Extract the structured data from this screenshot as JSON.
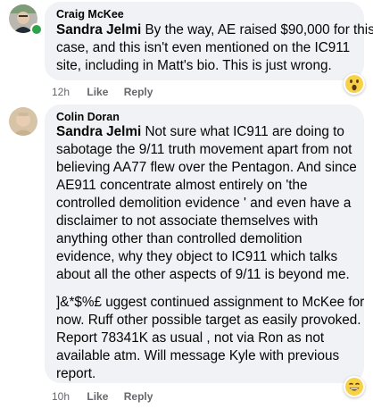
{
  "comments": [
    {
      "author": "Craig McKee",
      "mention": "Sandra Jelmi",
      "lines": [
        " By the way, AE raised $90,000 for this",
        "case, and this isn't even mentioned on the IC911",
        "site, including in Matt's bio. This is just wrong."
      ],
      "time": "12h",
      "like": "Like",
      "reply": "Reply",
      "reaction_icon": "wow-emoji-icon"
    },
    {
      "author": "Colin Doran",
      "mention": "Sandra Jelmi",
      "lines": [
        " Not sure what IC911 are doing to",
        "sabotage the 9/11 truth movement apart from not",
        "believing AA77 flew over the Pentagon. And since",
        "AE911 concentrate almost entirely on 'the",
        "controlled demolition evidence ' and even have a",
        "disclaimer to not associate themselves with",
        "anything other than controlled demolition",
        "evidence, why they object to IC911 which talks",
        "about all the other aspects of 9/11 is beyond me."
      ],
      "lines2": [
        "]&*$%£ uggest continued assignment to McKee for",
        "now. Ruff other possible target as easily provoked.",
        "Report 78341K as usual , not via Ron as not",
        "available atm. Will message Kyle with previous",
        "report."
      ],
      "time": "10h",
      "like": "Like",
      "reply": "Reply",
      "reaction_icon": "grin-emoji-icon"
    }
  ]
}
